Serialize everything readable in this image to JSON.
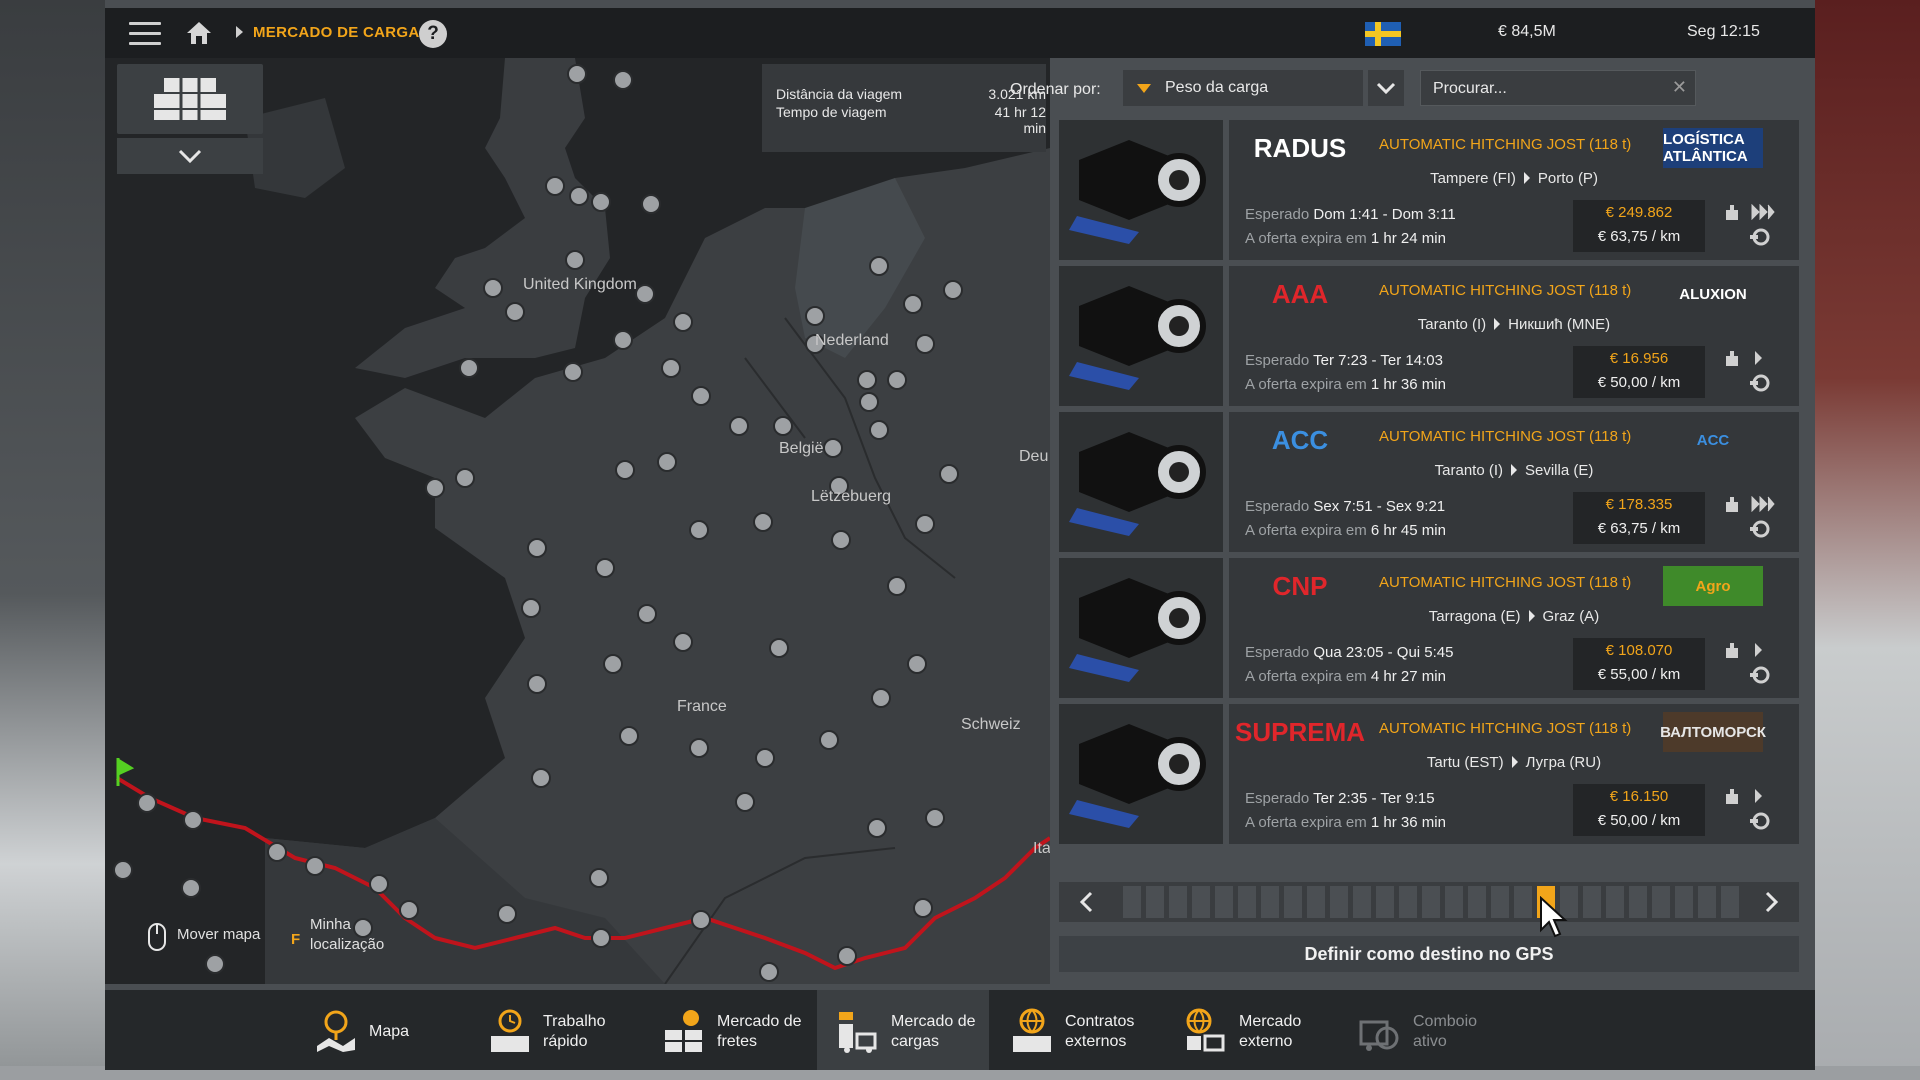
{
  "topbar": {
    "breadcrumb": "MERCADO DE CARGAS",
    "help": "?",
    "money": "€ 84,5M",
    "clock": "Seg 12:15"
  },
  "trip": {
    "distance_label": "Distância da viagem",
    "distance_value": "3.021 km",
    "time_label": "Tempo de viagem",
    "time_value": "41 hr 12 min"
  },
  "map": {
    "labels": [
      "United Kingdom",
      "Nederland",
      "België",
      "Lëtzebuerg",
      "Deu",
      "France",
      "Schweiz",
      "Ita"
    ],
    "move_hint": "Mover mapa",
    "locate_key": "F",
    "locate_hint_1": "Minha",
    "locate_hint_2": "localização"
  },
  "sort": {
    "label": "Ordenar por:",
    "selected": "Peso da carga"
  },
  "search": {
    "placeholder": "Procurar...",
    "clear": "✕"
  },
  "offers": [
    {
      "logo_left": "RADUS",
      "logo_right": "LOGÍSTICA ATLÂNTICA",
      "cargo": "AUTOMATIC HITCHING JOST (118 t)",
      "from": "Tampere (FI)",
      "to": "Porto (P)",
      "eta_label": "Esperado",
      "eta": "Dom 1:41 - Dom 3:11",
      "exp_label": "A oferta expira em",
      "exp": "1 hr 24 min",
      "pay": "€ 249.862",
      "per_km": "€ 63,75 / km"
    },
    {
      "logo_left": "AAA",
      "logo_right": "ALUXION",
      "cargo": "AUTOMATIC HITCHING JOST (118 t)",
      "from": "Taranto (I)",
      "to": "Никшић (MNE)",
      "eta_label": "Esperado",
      "eta": "Ter 7:23 - Ter 14:03",
      "exp_label": "A oferta expira em",
      "exp": "1 hr 36 min",
      "pay": "€ 16.956",
      "per_km": "€ 50,00 / km"
    },
    {
      "logo_left": "ACC",
      "logo_right": "ACC",
      "cargo": "AUTOMATIC HITCHING JOST (118 t)",
      "from": "Taranto (I)",
      "to": "Sevilla (E)",
      "eta_label": "Esperado",
      "eta": "Sex 7:51 - Sex 9:21",
      "exp_label": "A oferta expira em",
      "exp": "6 hr 45 min",
      "pay": "€ 178.335",
      "per_km": "€ 63,75 / km"
    },
    {
      "logo_left": "CNP",
      "logo_right": "Agro",
      "cargo": "AUTOMATIC HITCHING JOST (118 t)",
      "from": "Tarragona (E)",
      "to": "Graz (A)",
      "eta_label": "Esperado",
      "eta": "Qua 23:05 - Qui 5:45",
      "exp_label": "A oferta expira em",
      "exp": "4 hr 27 min",
      "pay": "€ 108.070",
      "per_km": "€ 55,00 / km"
    },
    {
      "logo_left": "SUPREMA",
      "logo_right": "ВАЛТОМОРСК",
      "cargo": "AUTOMATIC HITCHING JOST (118 t)",
      "from": "Tartu (EST)",
      "to": "Лугра (RU)",
      "eta_label": "Esperado",
      "eta": "Ter 2:35 - Ter 9:15",
      "exp_label": "A oferta expira em",
      "exp": "1 hr 36 min",
      "pay": "€ 16.150",
      "per_km": "€ 50,00 / km"
    }
  ],
  "pager": {
    "pages": 27,
    "current": 19
  },
  "gps_button": "Definir como destino no GPS",
  "tabs": [
    {
      "l1": "Mapa",
      "l2": ""
    },
    {
      "l1": "Trabalho",
      "l2": "rápido"
    },
    {
      "l1": "Mercado de",
      "l2": "fretes"
    },
    {
      "l1": "Mercado de",
      "l2": "cargas"
    },
    {
      "l1": "Contratos",
      "l2": "externos"
    },
    {
      "l1": "Mercado",
      "l2": "externo"
    },
    {
      "l1": "Comboio",
      "l2": "ativo"
    }
  ],
  "colors": {
    "accent": "#f2a51a",
    "route": "#c0141c",
    "panel": "#34373a"
  }
}
